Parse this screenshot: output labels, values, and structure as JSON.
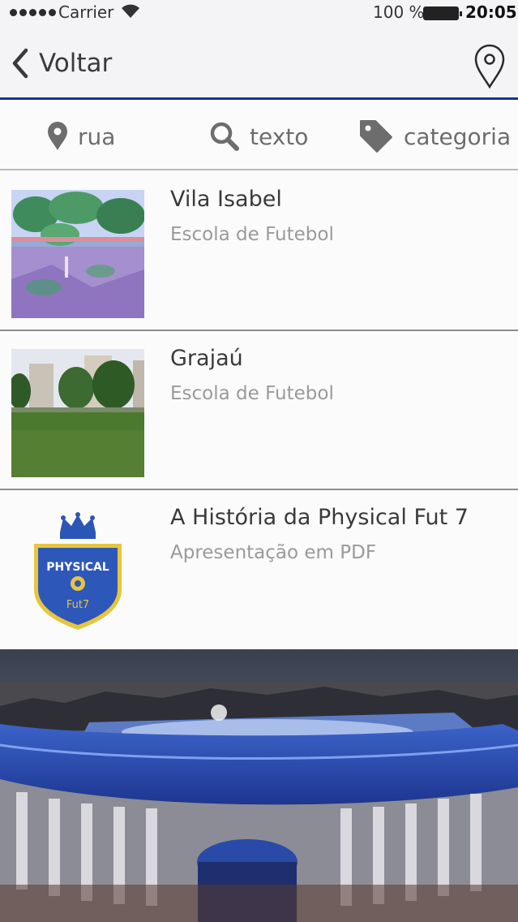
{
  "status_bar": {
    "carrier": "Carrier",
    "battery_percent": "100 %",
    "time": "20:05"
  },
  "nav": {
    "back_label": "Voltar",
    "accent_color": "#1a2fa0"
  },
  "filters": {
    "street": "rua",
    "text": "texto",
    "category": "categoria"
  },
  "items": [
    {
      "title": "Vila Isabel",
      "subtitle": "Escola de Futebol",
      "thumb": "park-photo"
    },
    {
      "title": "Grajaú",
      "subtitle": "Escola de Futebol",
      "thumb": "field-photo"
    },
    {
      "title": "A História da Physical Fut 7",
      "subtitle": "Apresentação em PDF",
      "thumb": "logo"
    }
  ],
  "logo": {
    "name": "PHYSICAL",
    "sub": "Fut7"
  },
  "icons": [
    "signal-icon",
    "wifi-icon",
    "battery-icon",
    "chevron-left-icon",
    "map-pin-icon",
    "location-pin-icon",
    "search-icon",
    "tag-icon"
  ]
}
